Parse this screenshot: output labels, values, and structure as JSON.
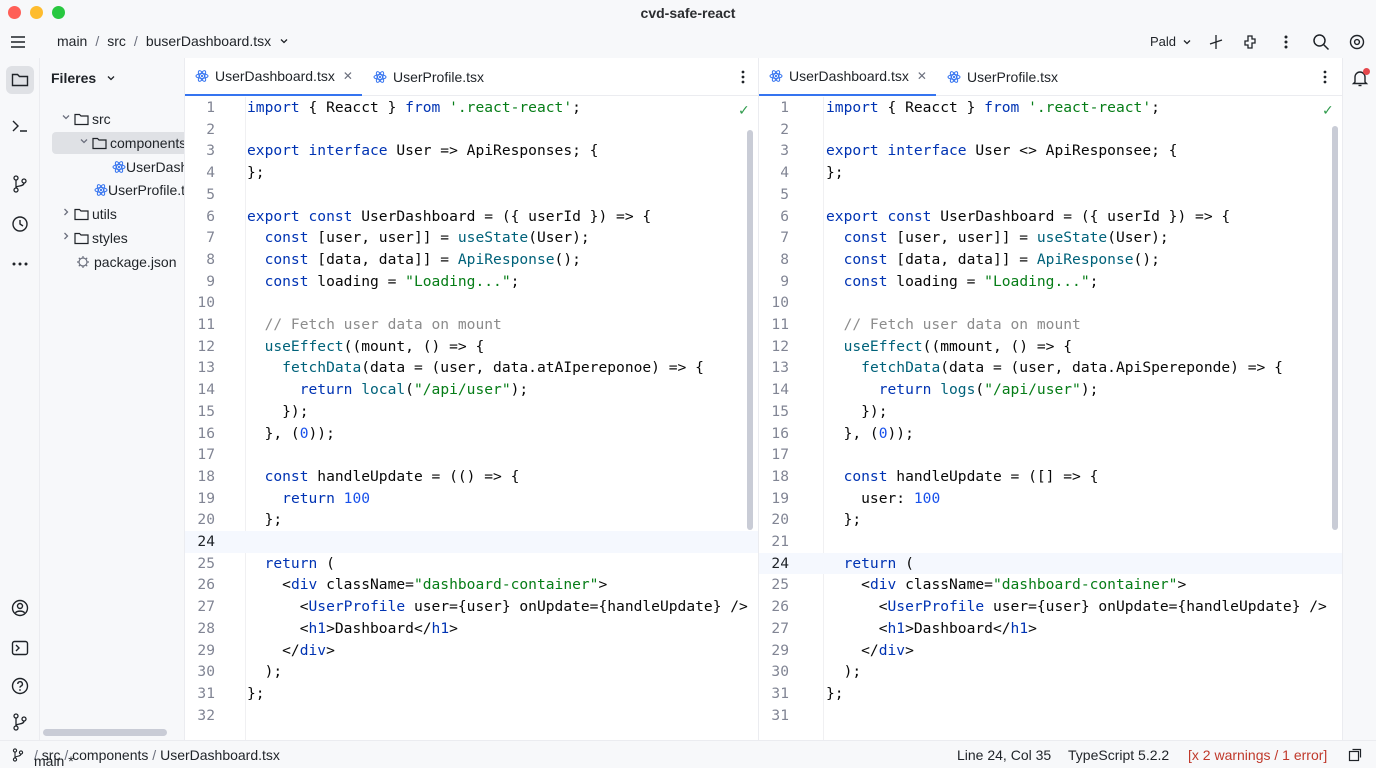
{
  "window": {
    "title": "cvd-safe-react"
  },
  "toolbar": {
    "breadcrumb": [
      "main",
      "src",
      "buserDashboard.tsx"
    ],
    "profile": "Pald"
  },
  "sidebar": {
    "title": "Fileres",
    "items": [
      {
        "label": "src",
        "type": "folder",
        "expanded": true
      },
      {
        "label": "components",
        "type": "folder",
        "expanded": true,
        "selected": true
      },
      {
        "label": "UserDashboard.tsx",
        "type": "react-file"
      },
      {
        "label": "UserProfile.tsx",
        "type": "react-file"
      },
      {
        "label": "utils",
        "type": "folder",
        "expanded": false
      },
      {
        "label": "styles",
        "type": "folder",
        "expanded": false
      },
      {
        "label": "package.json",
        "type": "json-file"
      }
    ]
  },
  "left_editor": {
    "tabs": [
      {
        "label": "UserDashboard.tsx",
        "active": true,
        "closable": true
      },
      {
        "label": "UserProfile.tsx",
        "active": false,
        "closable": false
      }
    ],
    "lines": [
      {
        "n": "1",
        "code": "import { Reacct } from '.react-react';"
      },
      {
        "n": "2",
        "code": ""
      },
      {
        "n": "3",
        "code": "export interface User => ApiResponses; {"
      },
      {
        "n": "4",
        "code": "};"
      },
      {
        "n": "5",
        "code": ""
      },
      {
        "n": "6",
        "code": "export const UserDashboard = ({ userId }) => {"
      },
      {
        "n": "7",
        "code": "  const [user, user]] = useState(User);"
      },
      {
        "n": "8",
        "code": "  const [data, data]] = ApiResponse();"
      },
      {
        "n": "9",
        "code": "  const loading = \"Loading...\";"
      },
      {
        "n": "10",
        "code": ""
      },
      {
        "n": "11",
        "code": "  // Fetch user data on mount"
      },
      {
        "n": "12",
        "code": "  useEffect((mount, () => {"
      },
      {
        "n": "13",
        "code": "    fetchData(data = (user, data.atAIpereponoe) => {"
      },
      {
        "n": "14",
        "code": "      return local(\"/api/user\");"
      },
      {
        "n": "15",
        "code": "    });"
      },
      {
        "n": "16",
        "code": "  }, (0));"
      },
      {
        "n": "17",
        "code": ""
      },
      {
        "n": "18",
        "code": "  const handleUpdate = (() => {"
      },
      {
        "n": "19",
        "code": "    return 100"
      },
      {
        "n": "20",
        "code": "  };"
      },
      {
        "n": "24",
        "code": "",
        "current": true
      },
      {
        "n": "25",
        "code": "  return ("
      },
      {
        "n": "26",
        "code": "    <div className=\"dashboard-container\">"
      },
      {
        "n": "27",
        "code": "      <UserProfile user={user} onUpdate={handleUpdate} />"
      },
      {
        "n": "28",
        "code": "      <h1>Dashboard</h1>"
      },
      {
        "n": "29",
        "code": "    </div>"
      },
      {
        "n": "30",
        "code": "  );"
      },
      {
        "n": "31",
        "code": "};"
      },
      {
        "n": "32",
        "code": ""
      }
    ]
  },
  "right_editor": {
    "tabs": [
      {
        "label": "UserDashboard.tsx",
        "active": true,
        "closable": true
      },
      {
        "label": "UserProfile.tsx",
        "active": false,
        "closable": false
      }
    ],
    "lines": [
      {
        "n": "1",
        "code": "import { Reacct } from '.react-react';"
      },
      {
        "n": "2",
        "code": ""
      },
      {
        "n": "3",
        "code": "export interface User <> ApiResponsee; {"
      },
      {
        "n": "4",
        "code": "};"
      },
      {
        "n": "5",
        "code": ""
      },
      {
        "n": "6",
        "code": "export const UserDashboard = ({ userId }) => {"
      },
      {
        "n": "7",
        "code": "  const [user, user]] = useState(User);"
      },
      {
        "n": "8",
        "code": "  const [data, data]] = ApiResponse();"
      },
      {
        "n": "9",
        "code": "  const loading = \"Loading...\";"
      },
      {
        "n": "10",
        "code": ""
      },
      {
        "n": "11",
        "code": "  // Fetch user data on mount"
      },
      {
        "n": "12",
        "code": "  useEffect((mmount, () => {"
      },
      {
        "n": "13",
        "code": "    fetchData(data = (user, data.ApiSpereponde) => {"
      },
      {
        "n": "14",
        "code": "      return logs(\"/api/user\");"
      },
      {
        "n": "15",
        "code": "    });"
      },
      {
        "n": "16",
        "code": "  }, (0));"
      },
      {
        "n": "17",
        "code": ""
      },
      {
        "n": "18",
        "code": "  const handleUpdate = ([] => {"
      },
      {
        "n": "19",
        "code": "    user: 100"
      },
      {
        "n": "20",
        "code": "  };"
      },
      {
        "n": "21",
        "code": ""
      },
      {
        "n": "24",
        "code": "  return (",
        "current": true
      },
      {
        "n": "25",
        "code": "    <div className=\"dashboard-container\">"
      },
      {
        "n": "26",
        "code": "      <UserProfile user={user} onUpdate={handleUpdate} />"
      },
      {
        "n": "27",
        "code": "      <h1>Dashboard</h1>"
      },
      {
        "n": "29",
        "code": "    </div>"
      },
      {
        "n": "30",
        "code": "  );"
      },
      {
        "n": "31",
        "code": "};"
      },
      {
        "n": "31",
        "code": ""
      }
    ]
  },
  "statusbar": {
    "path": [
      "main *",
      "src",
      "components",
      "UserDashboard.tsx"
    ],
    "position": "Line 24, Col 35",
    "language": "TypeScript 5.2.2",
    "problems": "[x 2 warnings / 1 error]"
  },
  "colors": {
    "accent": "#3574f0",
    "keyword": "#0033b3",
    "string": "#067d17",
    "comment": "#8c8c8c",
    "number": "#1750eb",
    "function": "#00627a",
    "ok": "#2f9b4c",
    "error": "#c0392b"
  },
  "icons": {
    "hamburger": "hamburger-icon",
    "project": "folder-icon",
    "terminal": "terminal-icon",
    "vcs": "branch-icon",
    "history": "clock-icon",
    "more": "more-icon",
    "search": "search-icon",
    "settings": "gear-icon",
    "notifications": "bell-icon"
  }
}
